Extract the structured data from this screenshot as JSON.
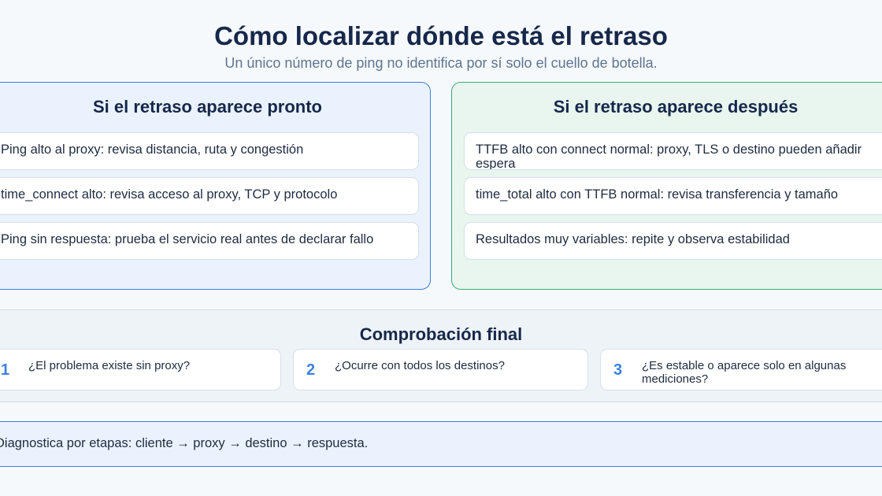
{
  "header": {
    "title": "Cómo localizar dónde está el retraso",
    "subtitle": "Un único número de ping no identifica por sí solo el cuello de botella."
  },
  "panels": {
    "early": {
      "title": "Si el retraso aparece pronto",
      "items": [
        "Ping alto al proxy: revisa distancia, ruta y congestión",
        "time_connect alto: revisa acceso al proxy, TCP y protocolo",
        "Ping sin respuesta: prueba el servicio real antes de declarar fallo"
      ]
    },
    "late": {
      "title": "Si el retraso aparece después",
      "items": [
        "TTFB alto con connect normal: proxy, TLS o destino pueden añadir espera",
        "time_total alto con TTFB normal: revisa transferencia y tamaño",
        "Resultados muy variables: repite y observa estabilidad"
      ]
    }
  },
  "final_check": {
    "title": "Comprobación final",
    "steps": [
      {
        "number": "1",
        "text": "¿El problema existe sin proxy?"
      },
      {
        "number": "2",
        "text": "¿Ocurre con todos los destinos?"
      },
      {
        "number": "3",
        "text": "¿Es estable o aparece solo en algunas mediciones?"
      }
    ]
  },
  "note": {
    "text": "Diagnostica por etapas: cliente → proxy → destino → respuesta."
  },
  "colors": {
    "left_panel_border": "#3f7fd6",
    "right_panel_border": "#3dae75",
    "step_number": "#3b82e0",
    "title_text": "#16284a"
  }
}
